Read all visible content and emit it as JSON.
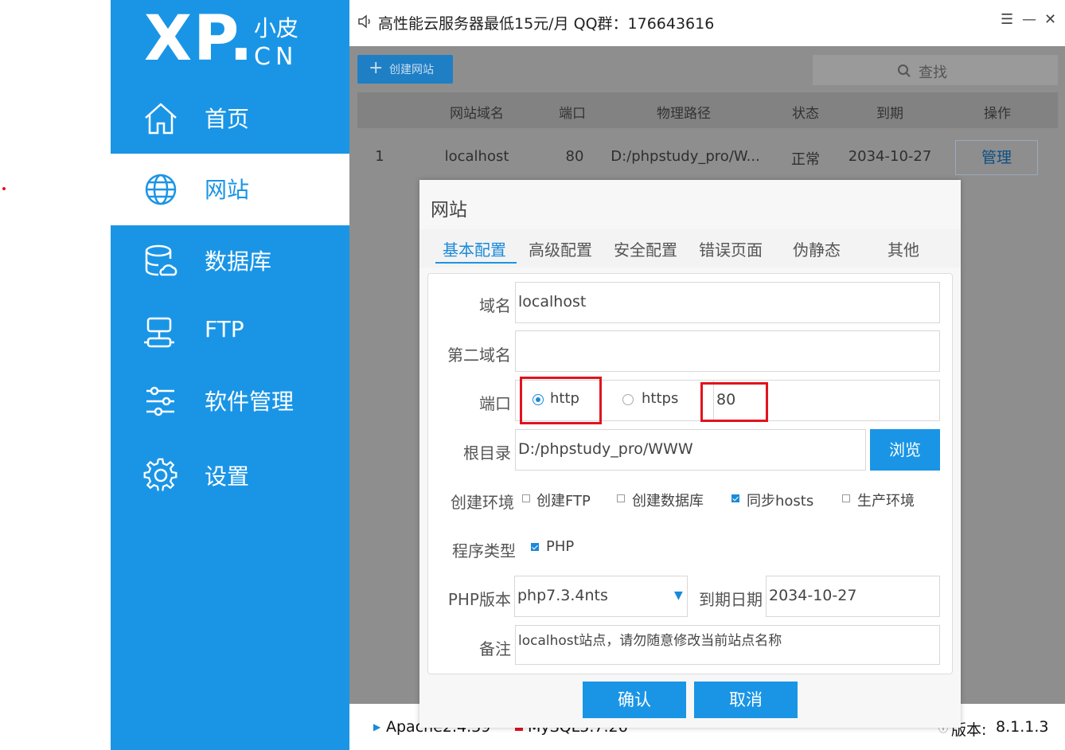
{
  "sidebar": {
    "logo_main": "XP.",
    "logo_sub": "小皮",
    "logo_cn": "CN",
    "items": [
      {
        "label": "首页",
        "icon": "home-icon"
      },
      {
        "label": "网站",
        "icon": "globe-icon",
        "active": true
      },
      {
        "label": "数据库",
        "icon": "database-icon"
      },
      {
        "label": "FTP",
        "icon": "ftp-icon"
      },
      {
        "label": "软件管理",
        "icon": "sliders-icon"
      },
      {
        "label": "设置",
        "icon": "gear-icon"
      }
    ]
  },
  "topbar": {
    "notice": "高性能云服务器最低15元/月  QQ群：176643616",
    "menu_glyph": "☰",
    "minimize_glyph": "—",
    "close_glyph": "✕"
  },
  "toolbar": {
    "create_label": "创建网站",
    "search_label": "查找"
  },
  "table": {
    "headers": [
      "网站域名",
      "端口",
      "物理路径",
      "状态",
      "到期",
      "操作"
    ],
    "rows": [
      {
        "index": "1",
        "domain": "localhost",
        "port": "80",
        "path": "D:/phpstudy_pro/W...",
        "status": "正常",
        "expire": "2034-10-27",
        "action": "管理"
      }
    ]
  },
  "statusbar": {
    "apache": "Apache2.4.39",
    "mysql": "MySQL5.7.26",
    "version_label": "版本:",
    "version": "8.1.1.3"
  },
  "dialog": {
    "title": "网站",
    "tabs": [
      "基本配置",
      "高级配置",
      "安全配置",
      "错误页面",
      "伪静态",
      "其他"
    ],
    "active_tab": "基本配置",
    "form": {
      "domain_label": "域名",
      "domain_value": "localhost",
      "second_domain_label": "第二域名",
      "second_domain_value": "",
      "port_label": "端口",
      "http_label": "http",
      "https_label": "https",
      "port_value": "80",
      "root_label": "根目录",
      "root_value": "D:/phpstudy_pro/WWW",
      "browse_label": "浏览",
      "env_label": "创建环境",
      "env_options": [
        {
          "label": "创建FTP",
          "checked": false
        },
        {
          "label": "创建数据库",
          "checked": false
        },
        {
          "label": "同步hosts",
          "checked": true
        },
        {
          "label": "生产环境",
          "checked": false
        }
      ],
      "program_label": "程序类型",
      "program_option": "PHP",
      "php_label": "PHP版本",
      "php_value": "php7.3.4nts",
      "expire_label": "到期日期",
      "expire_value": "2034-10-27",
      "note_label": "备注",
      "note_value": "localhost站点，请勿随意修改当前站点名称"
    },
    "confirm_label": "确认",
    "cancel_label": "取消"
  },
  "colors": {
    "accent": "#1a95e6",
    "highlight": "#e0141e"
  }
}
